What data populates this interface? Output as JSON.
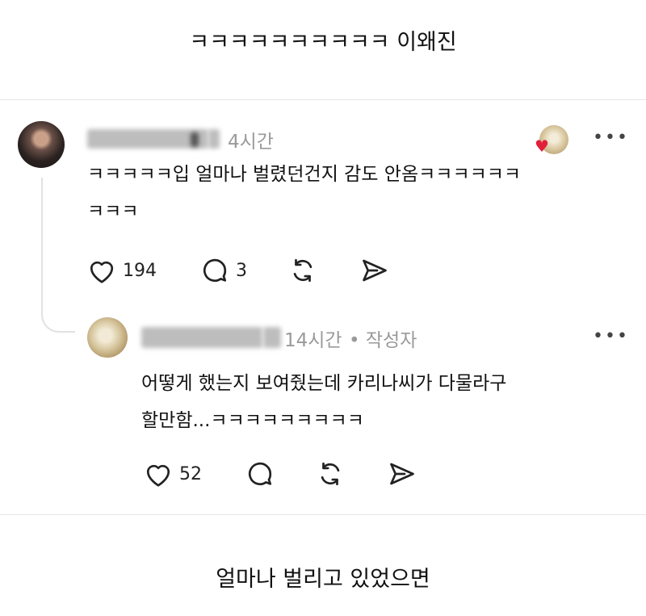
{
  "caption_top": "ㅋㅋㅋㅋㅋㅋㅋㅋㅋㅋ 이왜진",
  "caption_bottom": "얼마나 벌리고 있었으면",
  "comment": {
    "time": "4시간",
    "text_line1": "ㅋㅋㅋㅋㅋ입 얼마나 벌렸던건지 감도 안옴ㅋㅋㅋㅋㅋㅋ",
    "text_line2": "ㅋㅋㅋ",
    "likes": "194",
    "replies": "3",
    "more": "•••"
  },
  "reply": {
    "time": "14시간",
    "author_tag": "• 작성자",
    "text_line1": "어떻게 했는지 보여줬는데 카리나씨가 다물라구",
    "text_line2": "할만함...ㅋㅋㅋㅋㅋㅋㅋㅋㅋ",
    "likes": "52",
    "more": "•••"
  },
  "icons": {
    "like": "heart-outline-icon",
    "reply": "speech-bubble-icon",
    "repost": "repost-icon",
    "share": "send-icon"
  },
  "colors": {
    "liked_heart": "#e0203a",
    "meta_gray": "#9a9a9a",
    "text": "#111111"
  }
}
